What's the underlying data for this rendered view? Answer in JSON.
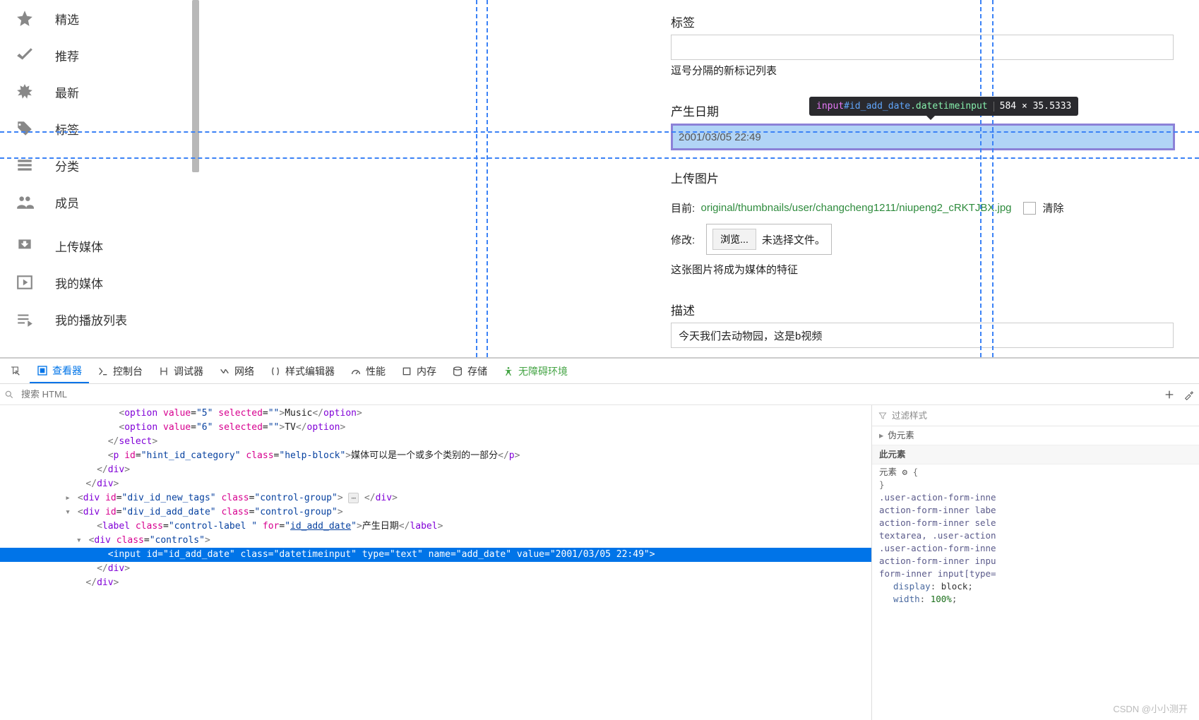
{
  "sidebar": {
    "items": [
      {
        "label": "精选"
      },
      {
        "label": "推荐"
      },
      {
        "label": "最新"
      },
      {
        "label": "标签"
      },
      {
        "label": "分类"
      },
      {
        "label": "成员"
      },
      {
        "label": "上传媒体"
      },
      {
        "label": "我的媒体"
      },
      {
        "label": "我的播放列表"
      }
    ]
  },
  "form": {
    "tags_label": "标签",
    "tags_help": "逗号分隔的新标记列表",
    "date_label": "产生日期",
    "date_value": "2001/03/05 22:49",
    "upload_label": "上传图片",
    "current_prefix": "目前:",
    "current_path": "original/thumbnails/user/changcheng1211/niupeng2_cRKTJBX.jpg",
    "clear_label": "清除",
    "modify_label": "修改:",
    "browse_btn": "浏览...",
    "no_file": "未选择文件。",
    "image_help": "这张图片将成为媒体的特征",
    "desc_label": "描述",
    "desc_value": "今天我们去动物园，这是b视频"
  },
  "tooltip": {
    "tag": "input",
    "id": "#id_add_date",
    "cls": ".datetimeinput",
    "dims": "584 × 35.5333"
  },
  "devtools": {
    "tabs": [
      "查看器",
      "控制台",
      "调试器",
      "网络",
      "样式编辑器",
      "性能",
      "内存",
      "存储",
      "无障碍环境"
    ],
    "search_placeholder": "搜索 HTML",
    "dom": {
      "line1_a": "<option value=\"5\" selected=\"\">",
      "line1_txt": "Music",
      "line1_b": "</option>",
      "line2_a": "<option value=\"6\" selected=\"\">",
      "line2_txt": "TV",
      "line2_b": "</option>",
      "line3": "</select>",
      "line4_a": "<p id=\"hint_id_category\" class=\"help-block\">",
      "line4_txt": "媒体可以是一个或多个类别的一部分",
      "line4_b": "</p>",
      "line5": "</div>",
      "line6": "</div>",
      "line7_a": "<div id=\"div_id_new_tags\" class=\"control-group\">",
      "line7_b": "</div>",
      "line8": "<div id=\"div_id_add_date\" class=\"control-group\">",
      "line9_a": "<label class=\"control-label \" for=\"id_add_date\">",
      "line9_txt": "产生日期",
      "line9_b": "</label>",
      "line10": "<div class=\"controls\">",
      "line11": "<input id=\"id_add_date\" class=\"datetimeinput\" type=\"text\" name=\"add_date\" value=\"2001/03/05 22:49\">",
      "line12": "</div>",
      "line13": "</div>"
    },
    "styles": {
      "filter_placeholder": "过滤样式",
      "pseudo": "伪元素",
      "this_el": "此元素",
      "elem_label": "元素",
      "gear": "⚙",
      "open_brace": "{",
      "close_brace": "}",
      "selectors": ".user-action-form-inne\naction-form-inner labe\naction-form-inner sele\ntextarea, .user-action\n.user-action-form-inne\naction-form-inner inpu\nform-inner input[type=",
      "display_prop": "display",
      "display_val": "block",
      "width_prop": "width",
      "width_val": "100%"
    }
  },
  "watermark": "CSDN @小小测开"
}
